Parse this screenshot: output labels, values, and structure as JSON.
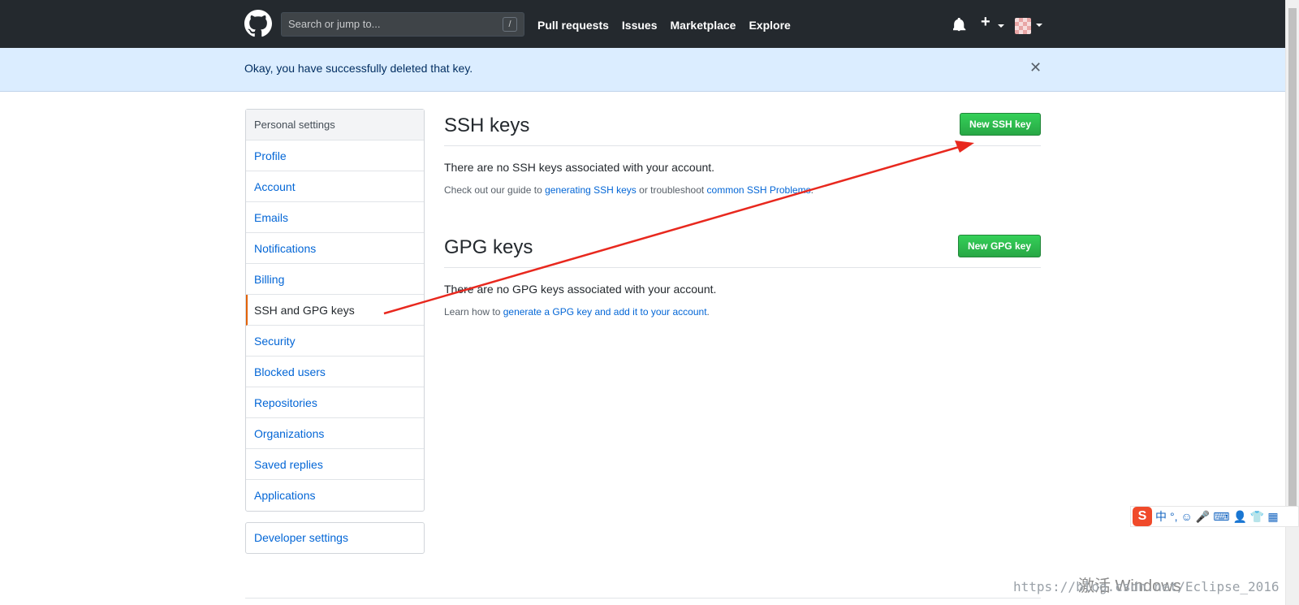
{
  "header": {
    "search_placeholder": "Search or jump to...",
    "search_shortcut": "/",
    "nav": [
      "Pull requests",
      "Issues",
      "Marketplace",
      "Explore"
    ],
    "plus_label": "+"
  },
  "flash": {
    "message": "Okay, you have successfully deleted that key.",
    "close_label": "✕"
  },
  "sidebar": {
    "heading": "Personal settings",
    "items": [
      {
        "label": "Profile"
      },
      {
        "label": "Account"
      },
      {
        "label": "Emails"
      },
      {
        "label": "Notifications"
      },
      {
        "label": "Billing"
      },
      {
        "label": "SSH and GPG keys",
        "selected": true
      },
      {
        "label": "Security"
      },
      {
        "label": "Blocked users"
      },
      {
        "label": "Repositories"
      },
      {
        "label": "Organizations"
      },
      {
        "label": "Saved replies"
      },
      {
        "label": "Applications"
      }
    ],
    "developer_settings": "Developer settings"
  },
  "ssh": {
    "title": "SSH keys",
    "button": "New SSH key",
    "empty": "There are no SSH keys associated with your account.",
    "help_prefix": "Check out our guide to ",
    "help_link1": "generating SSH keys",
    "help_mid": " or troubleshoot ",
    "help_link2": "common SSH Problems",
    "help_suffix": "."
  },
  "gpg": {
    "title": "GPG keys",
    "button": "New GPG key",
    "empty": "There are no GPG keys associated with your account.",
    "help_prefix": "Learn how to ",
    "help_link": "generate a GPG key and add it to your account",
    "help_suffix": "."
  },
  "ime": {
    "logo": "S",
    "items": [
      "中",
      "°,",
      "☺",
      "🎤",
      "⌨",
      "👤",
      "👕",
      "▦"
    ]
  },
  "overlay": {
    "watermark": "https://blog.csdn.net/Eclipse_2016",
    "activate_windows": "激活 Windows"
  },
  "colors": {
    "header_bg": "#24292e",
    "flash_bg": "#dbedff",
    "link": "#0366d6",
    "button_green": "#28a745",
    "selected_marker": "#e36209",
    "annotation_arrow": "#e8281e"
  }
}
